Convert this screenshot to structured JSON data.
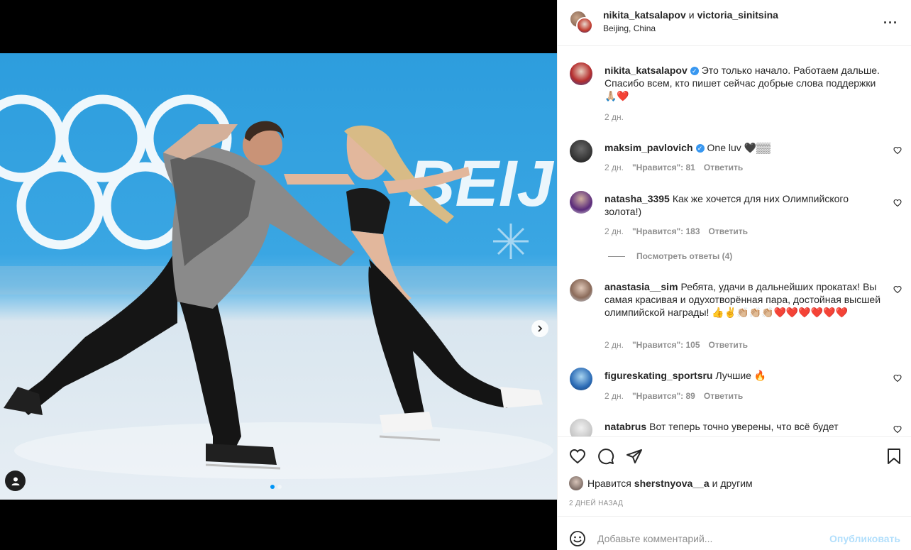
{
  "post": {
    "author1": "nikita_katsalapov",
    "conjunction": "и",
    "author2": "victoria_sinitsina",
    "location": "Beijing, China",
    "more_icon": "more-dots-icon"
  },
  "media": {
    "watermark_text": "BEIJ",
    "slide_count": 2,
    "active_slide": 1,
    "next_icon": "chevron-right-icon",
    "tag_icon": "user-tag-icon"
  },
  "caption": {
    "user": "nikita_katsalapov",
    "verified": true,
    "text": "Это только начало. Работаем дальше. Спасибо всем, кто пишет сейчас добрые слова поддержки 🙏🏼❤️",
    "time": "2 дн."
  },
  "comments": [
    {
      "user": "maksim_pavlovich",
      "verified": true,
      "text": "One luv 🖤▒▒",
      "time": "2 дн.",
      "likes": "\"Нравится\": 81",
      "reply": "Ответить"
    },
    {
      "user": "natasha_3395",
      "verified": false,
      "text": "Как же хочется для них Олимпийского золота!)",
      "time": "2 дн.",
      "likes": "\"Нравится\": 183",
      "reply": "Ответить"
    },
    {
      "user": "anastasia__sim",
      "verified": false,
      "text": "Ребята, удачи в дальнейших прокатах! Вы самая красивая и одухотворённая пара, достойная высшей олимпийской награды! 👍✌️👏🏼👏🏼👏🏼❤️❤️❤️❤️❤️❤️",
      "time": "2 дн.",
      "likes": "\"Нравится\": 105",
      "reply": "Ответить"
    },
    {
      "user": "figureskating_sportsru",
      "verified": false,
      "text": "Лучшие 🔥",
      "time": "2 дн.",
      "likes": "\"Нравится\": 89",
      "reply": "Ответить"
    },
    {
      "user": "natabrus",
      "verified": false,
      "text": "Вот теперь точно уверены, что всё будет",
      "time": "",
      "likes": "",
      "reply": ""
    }
  ],
  "view_replies": "Посмотреть ответы (4)",
  "actions": {
    "like_icon": "heart-icon",
    "comment_icon": "comment-icon",
    "share_icon": "share-icon",
    "save_icon": "bookmark-icon"
  },
  "likes": {
    "prefix": "Нравится",
    "user": "sherstnyova__a",
    "suffix": "и другим"
  },
  "timestamp": "2 ДНЕЙ НАЗАД",
  "add_comment": {
    "placeholder": "Добавьте комментарий...",
    "post_label": "Опубликовать",
    "emoji_icon": "emoji-icon"
  }
}
